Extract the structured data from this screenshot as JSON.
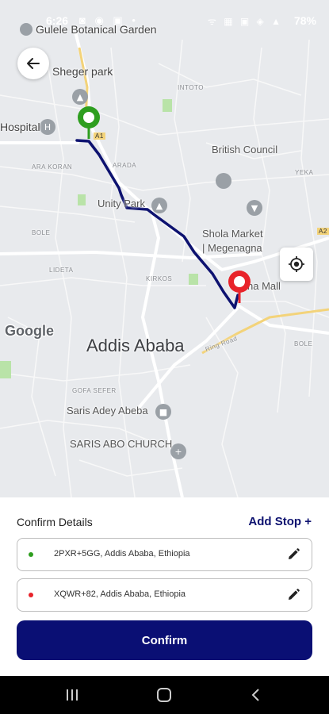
{
  "status_bar": {
    "time": "6:26",
    "left_icons": "◙ ◉ ▣ •",
    "right_icons": "ᯤ ▦ ▣ ◈ ▲",
    "battery": "78%"
  },
  "map": {
    "labels": {
      "garden": "Gulele Botanical Garden",
      "sheger": "Sheger park",
      "hospital": "Hospital",
      "british": "British Council",
      "unity": "Unity Park",
      "shola": "Shola Market",
      "megenagna": "| Megenagna",
      "mall": "na Mall",
      "city": "Addis Ababa",
      "saris": "Saris Adey Abeba",
      "saris_church": "SARIS ABO CHURCH",
      "intoto": "INTOTO",
      "arada": "ARADA",
      "arakori": "ARA KORAN",
      "yeka": "YEKA",
      "bole": "BOLE",
      "bole2": "BOLE",
      "lideta": "LIDETA",
      "kirkos": "KIRKOS",
      "gofa": "GOFA SEFER",
      "ring": "Ring Road",
      "a1": "A1",
      "a2": "A2"
    },
    "google": "Google",
    "route_color": "#0d1270",
    "origin_color": "#2e9e1f",
    "destination_color": "#e8232a"
  },
  "panel": {
    "title": "Confirm Details",
    "add_stop": "Add Stop +",
    "origin": "2PXR+5GG, Addis Ababa, Ethiopia",
    "destination": "XQWR+82, Addis Ababa, Ethiopia",
    "confirm": "Confirm"
  }
}
